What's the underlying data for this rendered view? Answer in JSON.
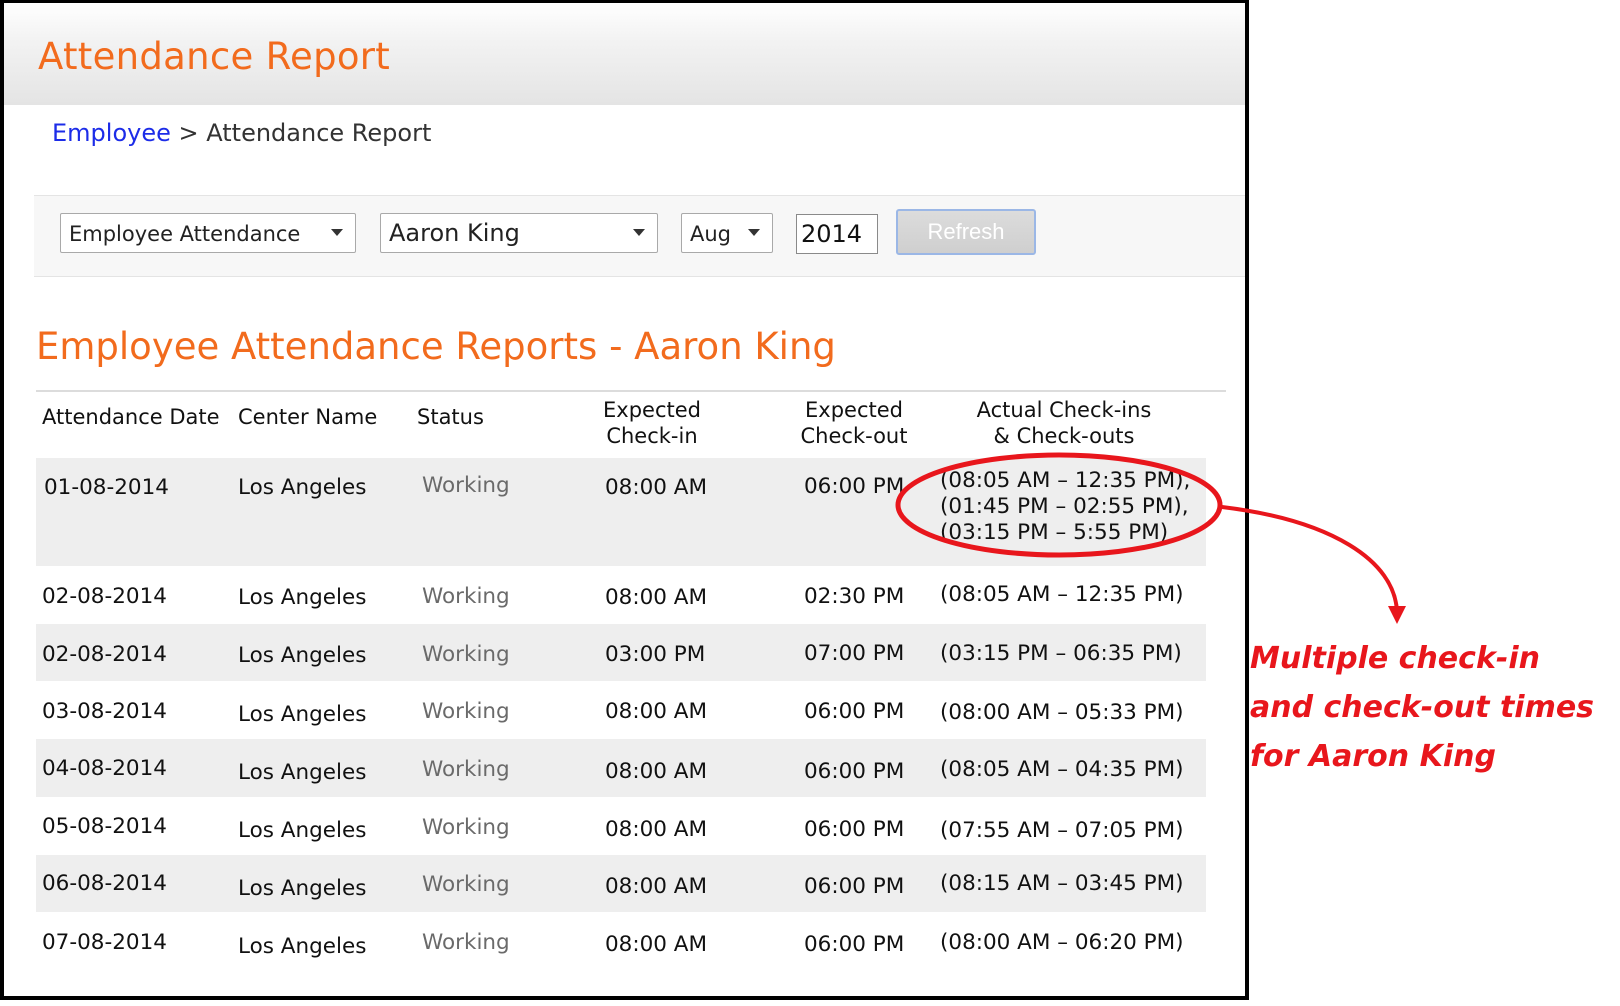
{
  "page": {
    "title": "Attendance Report"
  },
  "breadcrumb": {
    "link": "Employee",
    "separator": ">",
    "current": "Attendance Report"
  },
  "filters": {
    "report_type": "Employee Attendance",
    "employee": "Aaron King",
    "month": "Aug",
    "year": "2014",
    "refresh_label": "Refresh"
  },
  "report": {
    "title": "Employee Attendance Reports - Aaron King",
    "columns": {
      "date": "Attendance Date",
      "center": "Center Name",
      "status": "Status",
      "exp_in_1": "Expected",
      "exp_in_2": "Check-in",
      "exp_out_1": "Expected",
      "exp_out_2": "Check-out",
      "actual_1": "Actual Check-ins",
      "actual_2": "& Check-outs"
    },
    "rows": [
      {
        "date": "01-08-2014",
        "center": "Los Angeles",
        "status": "Working",
        "exp_in": "08:00 AM",
        "exp_out": "06:00 PM",
        "actual": [
          "(08:05 AM – 12:35 PM),",
          "(01:45 PM – 02:55 PM),",
          "(03:15 PM – 5:55 PM)"
        ]
      },
      {
        "date": "02-08-2014",
        "center": "Los Angeles",
        "status": "Working",
        "exp_in": "08:00 AM",
        "exp_out": "02:30 PM",
        "actual": [
          "(08:05 AM – 12:35 PM)"
        ]
      },
      {
        "date": "02-08-2014",
        "center": "Los Angeles",
        "status": "Working",
        "exp_in": "03:00 PM",
        "exp_out": "07:00 PM",
        "actual": [
          "(03:15 PM – 06:35 PM)"
        ]
      },
      {
        "date": "03-08-2014",
        "center": "Los Angeles",
        "status": "Working",
        "exp_in": "08:00 AM",
        "exp_out": "06:00 PM",
        "actual": [
          "(08:00 AM – 05:33 PM)"
        ]
      },
      {
        "date": "04-08-2014",
        "center": "Los Angeles",
        "status": "Working",
        "exp_in": "08:00 AM",
        "exp_out": "06:00 PM",
        "actual": [
          "(08:05 AM – 04:35 PM)"
        ]
      },
      {
        "date": "05-08-2014",
        "center": "Los Angeles",
        "status": "Working",
        "exp_in": "08:00 AM",
        "exp_out": "06:00 PM",
        "actual": [
          "(07:55 AM – 07:05 PM)"
        ]
      },
      {
        "date": "06-08-2014",
        "center": "Los Angeles",
        "status": "Working",
        "exp_in": "08:00 AM",
        "exp_out": "06:00 PM",
        "actual": [
          "(08:15 AM – 03:45 PM)"
        ]
      },
      {
        "date": "07-08-2014",
        "center": "Los Angeles",
        "status": "Working",
        "exp_in": "08:00 AM",
        "exp_out": "06:00 PM",
        "actual": [
          "(08:00 AM – 06:20 PM)"
        ]
      }
    ]
  },
  "annotation": {
    "lines": [
      "Multiple check-in",
      "and check-out times",
      "for Aaron King"
    ],
    "color": "#e8161c"
  },
  "colors": {
    "accent": "#f26b1d",
    "link": "#1c2ce8",
    "row_shade": "#eeeeee"
  }
}
